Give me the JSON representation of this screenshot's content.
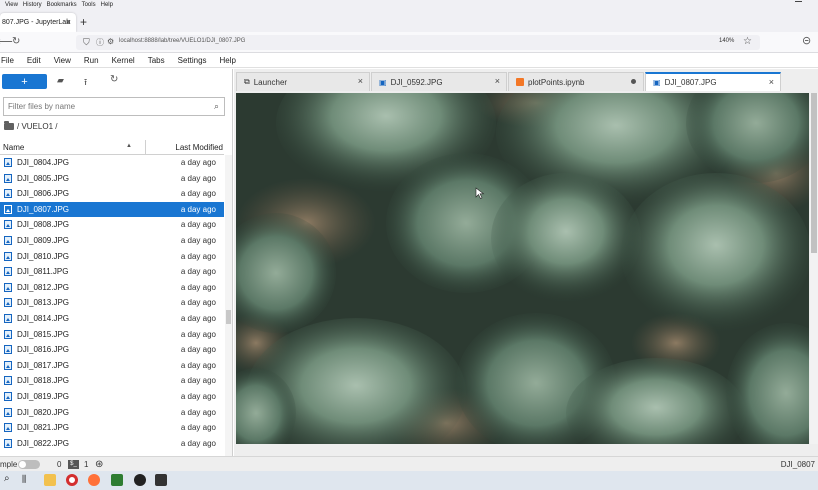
{
  "browser": {
    "menu": [
      "View",
      "History",
      "Bookmarks",
      "Tools",
      "Help"
    ],
    "tab_title": "807.JPG - JupyterLab",
    "url": "localhost:8888/lab/tree/VUELO1/DJI_0807.JPG",
    "zoom": "140%"
  },
  "jupyter": {
    "menu": [
      "File",
      "Edit",
      "View",
      "Run",
      "Kernel",
      "Tabs",
      "Settings",
      "Help"
    ]
  },
  "filebrowser": {
    "new_label": "+",
    "filter_placeholder": "Filter files by name",
    "breadcrumb": "/ VUELO1 /",
    "col_name": "Name",
    "col_modified": "Last Modified",
    "files": [
      {
        "name": "DJI_0804.JPG",
        "modified": "a day ago"
      },
      {
        "name": "DJI_0805.JPG",
        "modified": "a day ago"
      },
      {
        "name": "DJI_0806.JPG",
        "modified": "a day ago"
      },
      {
        "name": "DJI_0807.JPG",
        "modified": "a day ago"
      },
      {
        "name": "DJI_0808.JPG",
        "modified": "a day ago"
      },
      {
        "name": "DJI_0809.JPG",
        "modified": "a day ago"
      },
      {
        "name": "DJI_0810.JPG",
        "modified": "a day ago"
      },
      {
        "name": "DJI_0811.JPG",
        "modified": "a day ago"
      },
      {
        "name": "DJI_0812.JPG",
        "modified": "a day ago"
      },
      {
        "name": "DJI_0813.JPG",
        "modified": "a day ago"
      },
      {
        "name": "DJI_0814.JPG",
        "modified": "a day ago"
      },
      {
        "name": "DJI_0815.JPG",
        "modified": "a day ago"
      },
      {
        "name": "DJI_0816.JPG",
        "modified": "a day ago"
      },
      {
        "name": "DJI_0817.JPG",
        "modified": "a day ago"
      },
      {
        "name": "DJI_0818.JPG",
        "modified": "a day ago"
      },
      {
        "name": "DJI_0819.JPG",
        "modified": "a day ago"
      },
      {
        "name": "DJI_0820.JPG",
        "modified": "a day ago"
      },
      {
        "name": "DJI_0821.JPG",
        "modified": "a day ago"
      },
      {
        "name": "DJI_0822.JPG",
        "modified": "a day ago"
      }
    ],
    "selected_index": 3
  },
  "tabs": [
    {
      "label": "Launcher",
      "icon": "launcher-icon"
    },
    {
      "label": "DJI_0592.JPG",
      "icon": "image-icon"
    },
    {
      "label": "plotPoints.ipynb",
      "icon": "notebook-icon",
      "unsaved": true
    },
    {
      "label": "DJI_0807.JPG",
      "icon": "image-icon",
      "active": true
    }
  ],
  "status": {
    "simple_label": "mple",
    "terminals": "0",
    "kernels": "1",
    "right_label": "DJI_0807"
  },
  "colors": {
    "accent": "#1976d2",
    "tree_dark": "#2f4a3c",
    "tree_light": "#8ea694",
    "ground": "#7a6a55"
  }
}
